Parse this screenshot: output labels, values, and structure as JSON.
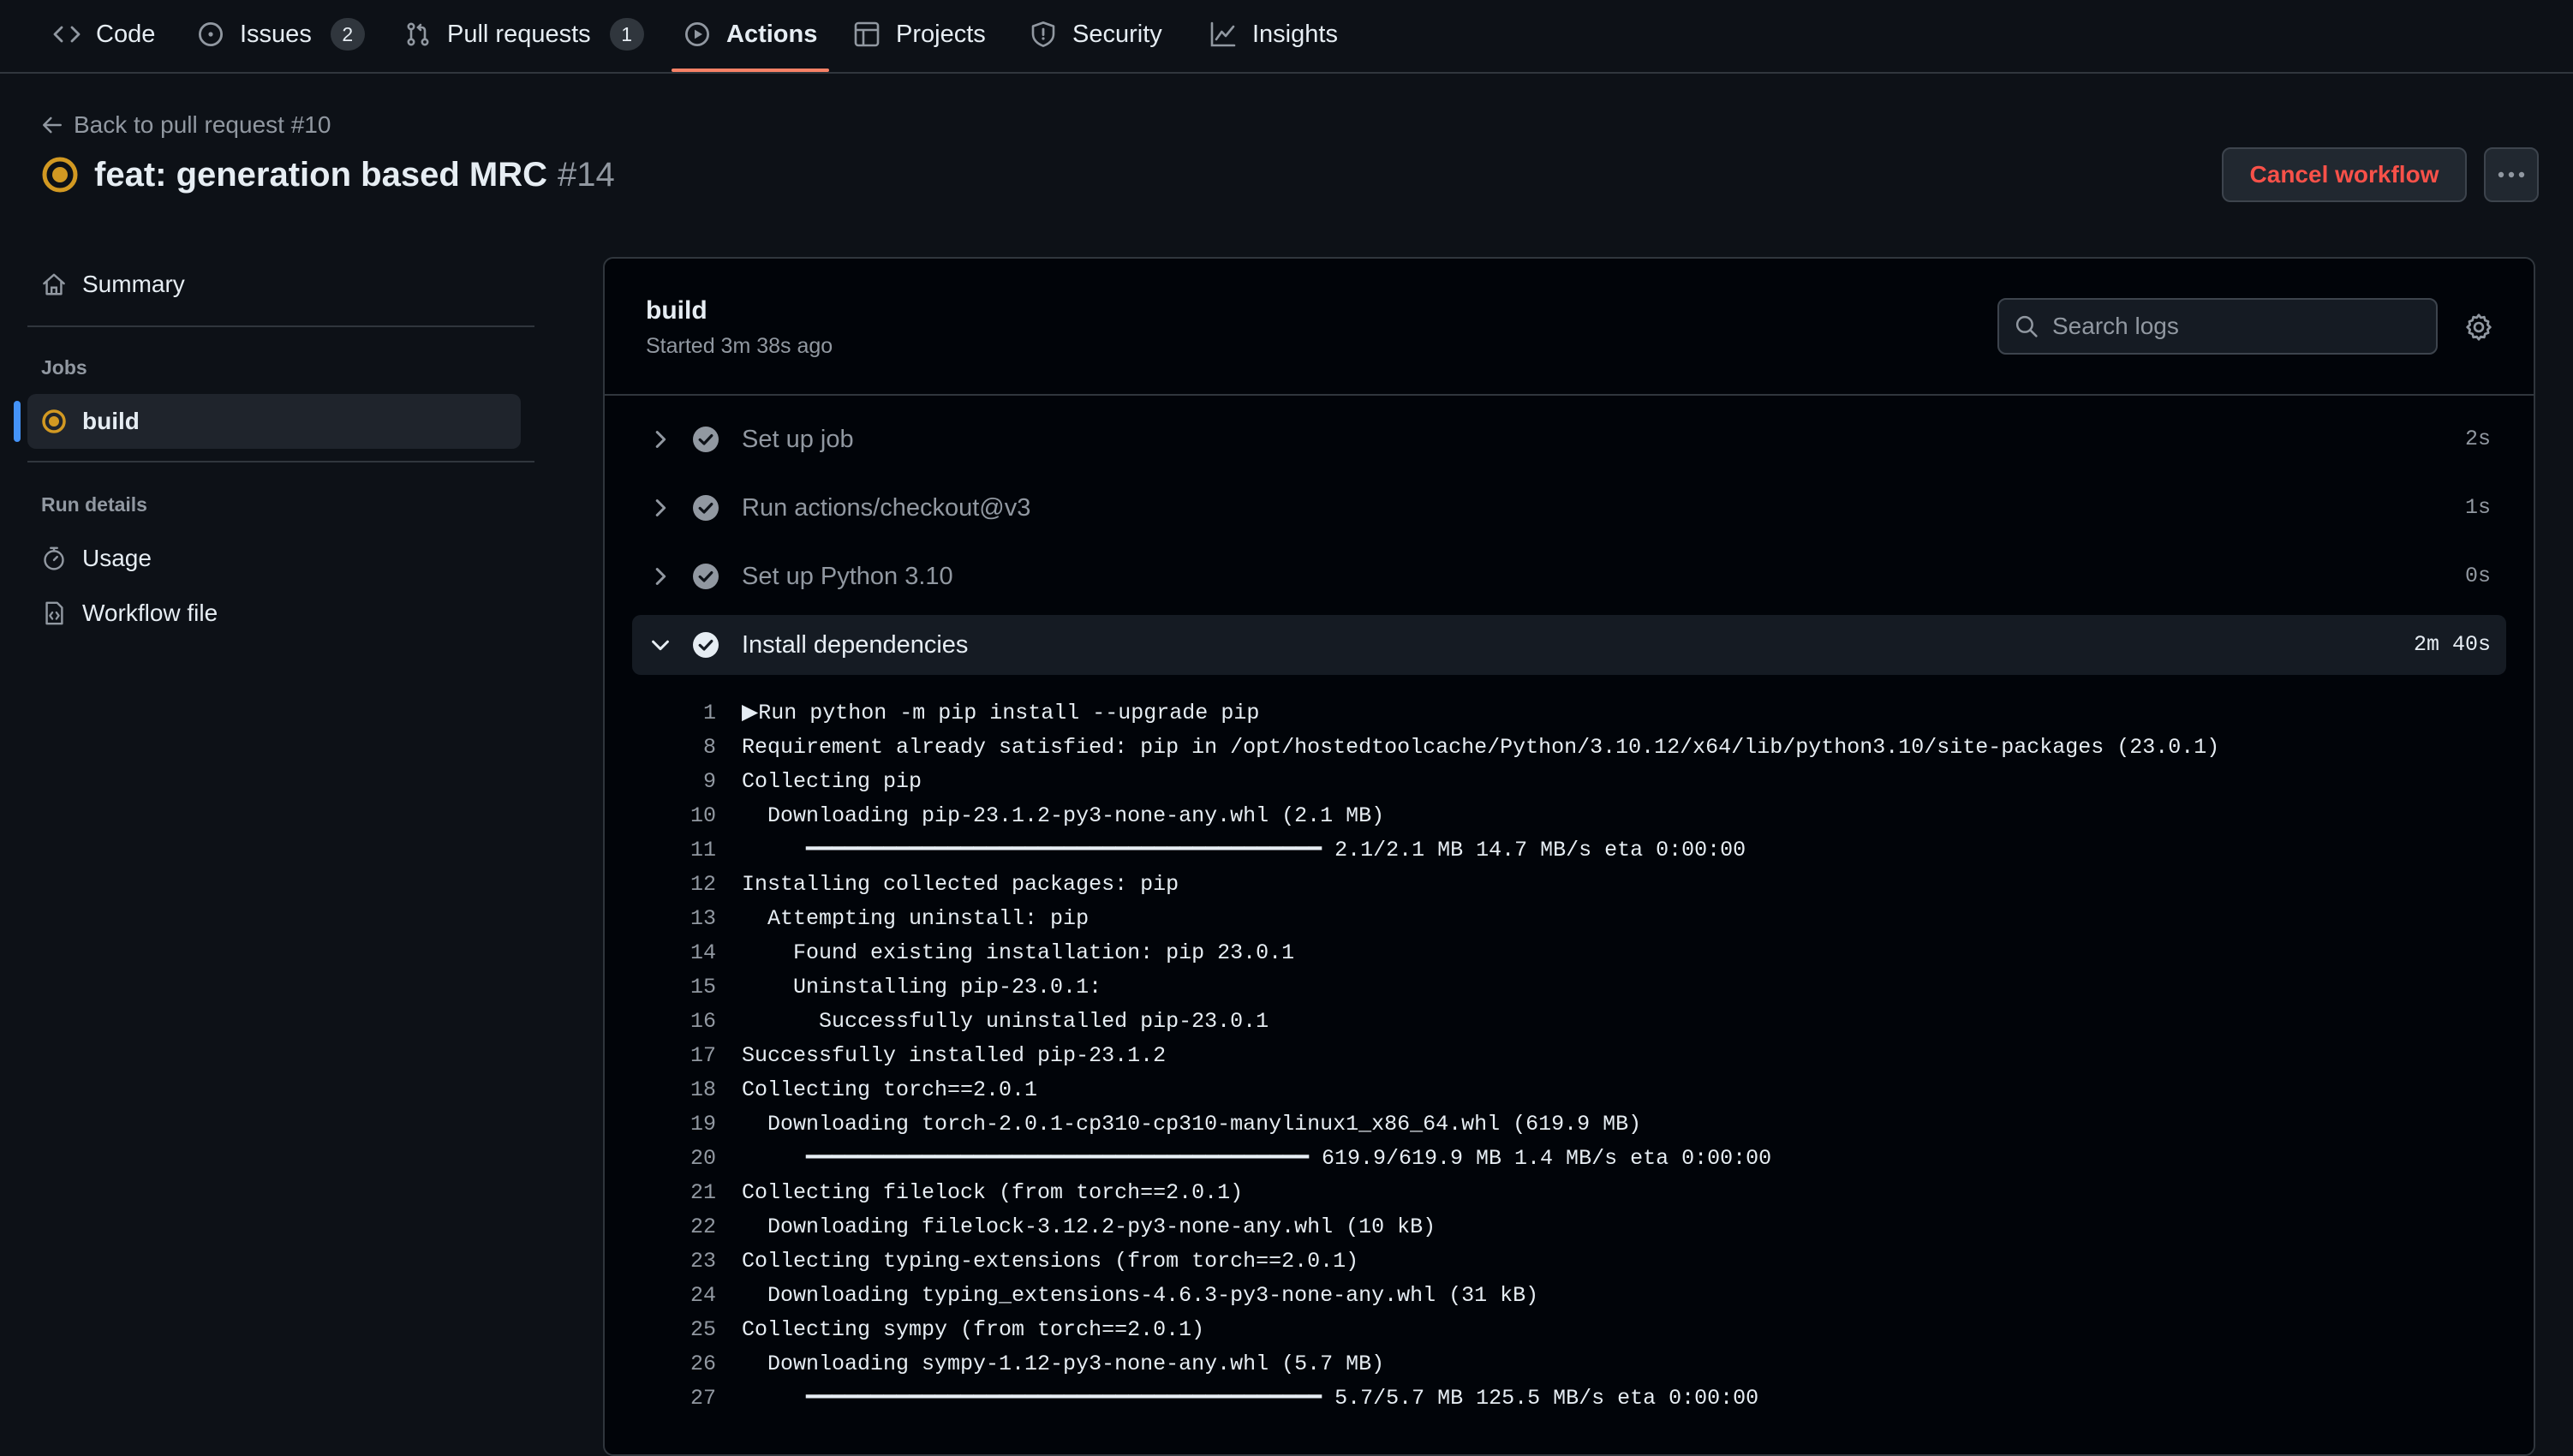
{
  "nav": {
    "tabs": [
      {
        "label": "Code",
        "icon": "code-icon"
      },
      {
        "label": "Issues",
        "icon": "issue-opened-icon",
        "count": "2"
      },
      {
        "label": "Pull requests",
        "icon": "git-pull-request-icon",
        "count": "1"
      },
      {
        "label": "Actions",
        "icon": "play-icon",
        "active": true
      },
      {
        "label": "Projects",
        "icon": "table-icon"
      },
      {
        "label": "Security",
        "icon": "shield-icon"
      },
      {
        "label": "Insights",
        "icon": "graph-icon"
      }
    ]
  },
  "header": {
    "back_link": "Back to pull request #10",
    "title": "feat: generation based MRC",
    "run_number": "#14",
    "status": "in_progress",
    "cancel_button": "Cancel workflow"
  },
  "sidebar": {
    "summary_label": "Summary",
    "jobs_heading": "Jobs",
    "jobs": [
      {
        "label": "build",
        "status": "in_progress"
      }
    ],
    "run_details_heading": "Run details",
    "usage_label": "Usage",
    "workflow_file_label": "Workflow file"
  },
  "job": {
    "title": "build",
    "started": "Started 3m 38s ago",
    "search_placeholder": "Search logs",
    "steps": [
      {
        "name": "Set up job",
        "duration": "2s",
        "status": "success",
        "expanded": false
      },
      {
        "name": "Run actions/checkout@v3",
        "duration": "1s",
        "status": "success",
        "expanded": false
      },
      {
        "name": "Set up Python 3.10",
        "duration": "0s",
        "status": "success",
        "expanded": false
      },
      {
        "name": "Install dependencies",
        "duration": "2m 40s",
        "status": "success",
        "expanded": true
      }
    ],
    "log_lines": [
      {
        "n": "1",
        "text": "▶Run python -m pip install --upgrade pip"
      },
      {
        "n": "8",
        "text": "Requirement already satisfied: pip in /opt/hostedtoolcache/Python/3.10.12/x64/lib/python3.10/site-packages (23.0.1)"
      },
      {
        "n": "9",
        "text": "Collecting pip"
      },
      {
        "n": "10",
        "text": "  Downloading pip-23.1.2-py3-none-any.whl (2.1 MB)"
      },
      {
        "n": "11",
        "text": "     ━━━━━━━━━━━━━━━━━━━━━━━━━━━━━━━━━━━━━━━━ 2.1/2.1 MB 14.7 MB/s eta 0:00:00"
      },
      {
        "n": "12",
        "text": "Installing collected packages: pip"
      },
      {
        "n": "13",
        "text": "  Attempting uninstall: pip"
      },
      {
        "n": "14",
        "text": "    Found existing installation: pip 23.0.1"
      },
      {
        "n": "15",
        "text": "    Uninstalling pip-23.0.1:"
      },
      {
        "n": "16",
        "text": "      Successfully uninstalled pip-23.0.1"
      },
      {
        "n": "17",
        "text": "Successfully installed pip-23.1.2"
      },
      {
        "n": "18",
        "text": "Collecting torch==2.0.1"
      },
      {
        "n": "19",
        "text": "  Downloading torch-2.0.1-cp310-cp310-manylinux1_x86_64.whl (619.9 MB)"
      },
      {
        "n": "20",
        "text": "     ━━━━━━━━━━━━━━━━━━━━━━━━━━━━━━━━━━━━━━━ 619.9/619.9 MB 1.4 MB/s eta 0:00:00"
      },
      {
        "n": "21",
        "text": "Collecting filelock (from torch==2.0.1)"
      },
      {
        "n": "22",
        "text": "  Downloading filelock-3.12.2-py3-none-any.whl (10 kB)"
      },
      {
        "n": "23",
        "text": "Collecting typing-extensions (from torch==2.0.1)"
      },
      {
        "n": "24",
        "text": "  Downloading typing_extensions-4.6.3-py3-none-any.whl (31 kB)"
      },
      {
        "n": "25",
        "text": "Collecting sympy (from torch==2.0.1)"
      },
      {
        "n": "26",
        "text": "  Downloading sympy-1.12-py3-none-any.whl (5.7 MB)"
      },
      {
        "n": "27",
        "text": "     ━━━━━━━━━━━━━━━━━━━━━━━━━━━━━━━━━━━━━━━━ 5.7/5.7 MB 125.5 MB/s eta 0:00:00"
      }
    ]
  },
  "colors": {
    "background": "#0d1117",
    "log_background": "#010409",
    "accent_underline": "#f78166",
    "in_progress": "#d29922",
    "cancel_text": "#f85149",
    "active_marker": "#4493f8"
  }
}
